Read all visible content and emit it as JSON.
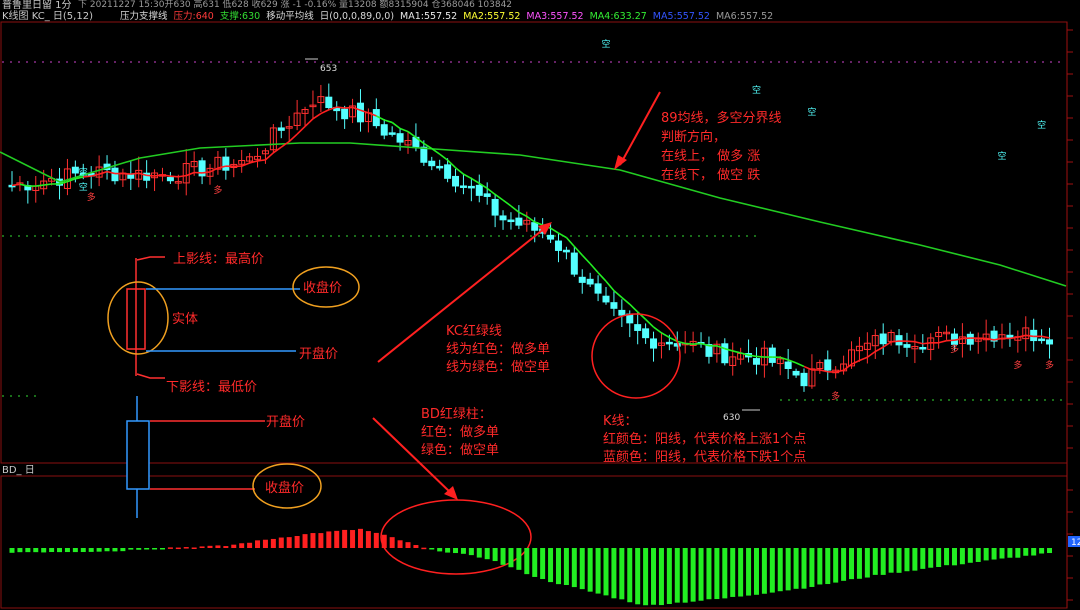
{
  "header": {
    "title": "普鲁里日留 1分",
    "stock_label": "K线图 KC_ 日(5,12)",
    "info": "下 20211227 15:30开630 高631 低628 收629 涨 -1 -0.16% 量13208 额8315904 仓368046 103842",
    "legends": [
      {
        "text": "压力支撑线",
        "color": "#d8d8d8"
      },
      {
        "text": "压力:640",
        "color": "#ff3b3b"
      },
      {
        "text": "支撑:630",
        "color": "#33dd33"
      },
      {
        "text": "移动平均线",
        "color": "#d8d8d8"
      },
      {
        "text": "日(0,0,0,89,0,0)",
        "color": "#d8d8d8"
      },
      {
        "text": "MA1:557.52",
        "color": "#e8e8e8"
      },
      {
        "text": "MA2:557.52",
        "color": "#ffff33"
      },
      {
        "text": "MA3:557.52",
        "color": "#ff55ff"
      },
      {
        "text": "MA4:633.27",
        "color": "#33ee33"
      },
      {
        "text": "MA5:557.52",
        "color": "#3355ff"
      },
      {
        "text": "MA6:557.52",
        "color": "#999999"
      }
    ]
  },
  "lower_panel": {
    "label": "BD_ 日",
    "right_value": "12"
  },
  "annotations": {
    "upper_shadow": "上影线：最高价",
    "body": "实体",
    "close_price_1": "收盘价",
    "open_price_1": "开盘价",
    "lower_shadow": "下影线：最低价",
    "open_price_2": "开盘价",
    "close_price_2": "收盘价",
    "ma89_lines": [
      "89均线，多空分界线",
      "判断方向，",
      "在线上， 做多 涨",
      "在线下， 做空 跌"
    ],
    "kc_lines": [
      "KC红绿线",
      "线为红色：做多单",
      "线为绿色：做空单"
    ],
    "bd_lines": [
      "BD红绿柱：",
      "红色：做多单",
      "绿色：做空单"
    ],
    "k_lines": [
      "K线：",
      "红颜色：阳线，代表价格上涨1个点",
      "蓝颜色：阳线，代表价格下跌1个点"
    ]
  },
  "markers": {
    "high_label": "653",
    "low_label": "630",
    "sell": "空",
    "buy": "多"
  },
  "colors": {
    "up": "#ff3030",
    "down": "#54ffff",
    "ma89": "#22cc22",
    "kc_red": "#ff2020",
    "kc_green": "#22ee22",
    "annot_text": "#ff2a2a",
    "annot_blue": "#3399ff",
    "annot_orange": "#f0a020"
  },
  "chart_data": {
    "type": "candlestick",
    "y_range": [
      628,
      655
    ],
    "series": [
      {
        "name": "K线",
        "ohlc_start": 645.6,
        "high": 653,
        "low": 630
      },
      {
        "name": "89均线"
      },
      {
        "name": "KC红绿线"
      },
      {
        "name": "BD红绿柱",
        "type": "bar"
      }
    ],
    "close_path_knots": [
      [
        0,
        645.6
      ],
      [
        10,
        646.6
      ],
      [
        20,
        646.4
      ],
      [
        30,
        647.5
      ],
      [
        38,
        652.1
      ],
      [
        45,
        650.5
      ],
      [
        55,
        646.7
      ],
      [
        62,
        643.1
      ],
      [
        68,
        641.9
      ],
      [
        75,
        636.2
      ],
      [
        80,
        634.1
      ],
      [
        85,
        633.9
      ],
      [
        88,
        633.1
      ],
      [
        95,
        632.7
      ],
      [
        100,
        631.1
      ],
      [
        104,
        632.4
      ],
      [
        110,
        634.1
      ],
      [
        118,
        634.1
      ],
      [
        125,
        634.6
      ],
      [
        131,
        634.4
      ]
    ],
    "bd_knots": [
      [
        0,
        -4
      ],
      [
        13,
        -3
      ],
      [
        18,
        0
      ],
      [
        27,
        2
      ],
      [
        33,
        9
      ],
      [
        38,
        14
      ],
      [
        44,
        18
      ],
      [
        48,
        10
      ],
      [
        52,
        0
      ],
      [
        60,
        -10
      ],
      [
        67,
        -30
      ],
      [
        80,
        -55
      ],
      [
        90,
        -48
      ],
      [
        100,
        -38
      ],
      [
        110,
        -25
      ],
      [
        120,
        -15
      ],
      [
        131,
        -5
      ]
    ]
  }
}
